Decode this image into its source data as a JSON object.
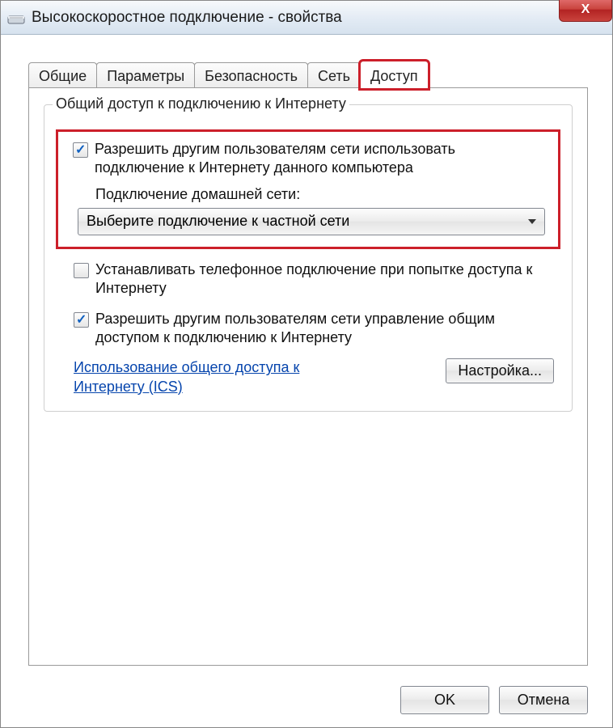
{
  "window": {
    "title": "Высокоскоростное подключение - свойства",
    "close_glyph": "X"
  },
  "tabs": {
    "general": "Общие",
    "params": "Параметры",
    "security": "Безопасность",
    "network": "Сеть",
    "access": "Доступ"
  },
  "group": {
    "title": "Общий доступ к подключению к Интернету"
  },
  "chk1": {
    "label": "Разрешить другим пользователям сети использовать подключение к Интернету данного компьютера",
    "sublabel": "Подключение домашней сети:"
  },
  "combo": {
    "text": "Выберите подключение к частной сети"
  },
  "chk2": {
    "label": "Устанавливать телефонное подключение при попытке доступа к Интернету"
  },
  "chk3": {
    "label": "Разрешить другим пользователям сети управление общим доступом к подключению к Интернету"
  },
  "link": {
    "text": "Использование общего доступа к Интернету (ICS)"
  },
  "buttons": {
    "settings": "Настройка...",
    "ok": "OK",
    "cancel": "Отмена"
  }
}
